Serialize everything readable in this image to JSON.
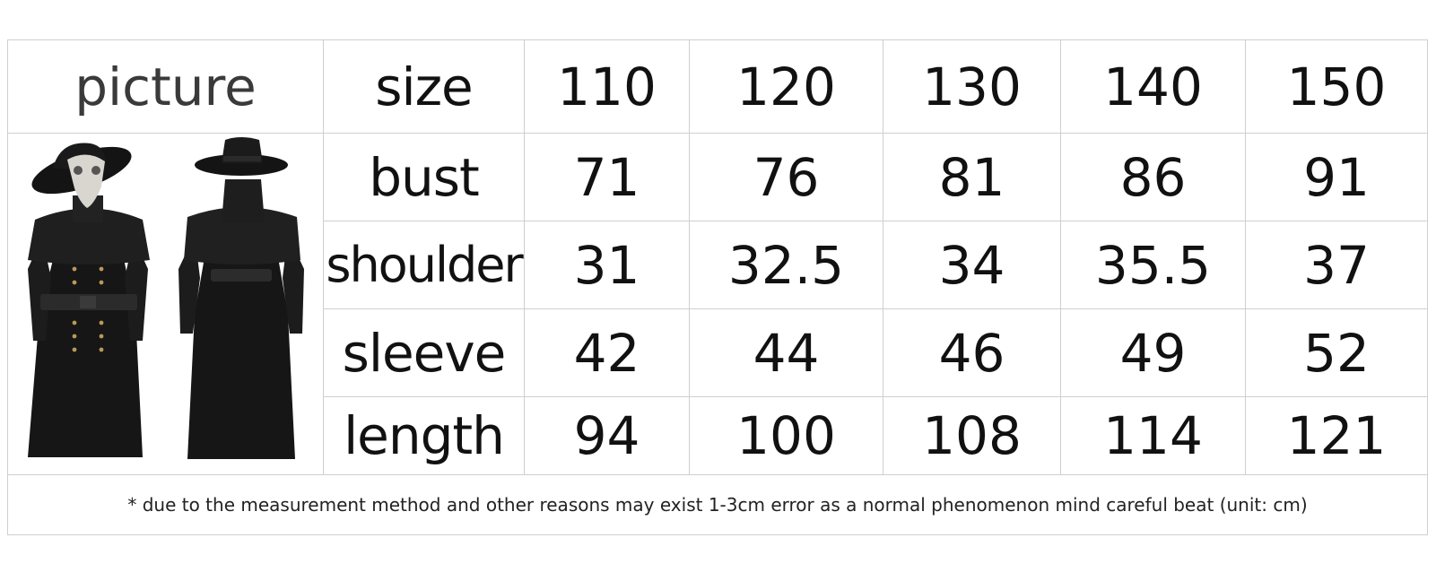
{
  "header": {
    "picture_label": "picture",
    "size_label": "size",
    "sizes": [
      "110",
      "120",
      "130",
      "140",
      "150"
    ]
  },
  "rows": [
    {
      "label": "bust",
      "values": [
        "71",
        "76",
        "81",
        "86",
        "91"
      ]
    },
    {
      "label": "shoulder",
      "values": [
        "31",
        "32.5",
        "34",
        "35.5",
        "37"
      ]
    },
    {
      "label": "sleeve",
      "values": [
        "42",
        "44",
        "46",
        "49",
        "52"
      ]
    },
    {
      "label": "length",
      "values": [
        "94",
        "100",
        "108",
        "114",
        "121"
      ]
    }
  ],
  "note": "* due to the measurement method and other reasons may exist 1-3cm error as a normal phenomenon mind careful beat (unit: cm)",
  "picture": {
    "subject": "plague-doctor-costume-front-and-back",
    "costume_color": "#161616",
    "mask_color": "#d9d6d0"
  }
}
